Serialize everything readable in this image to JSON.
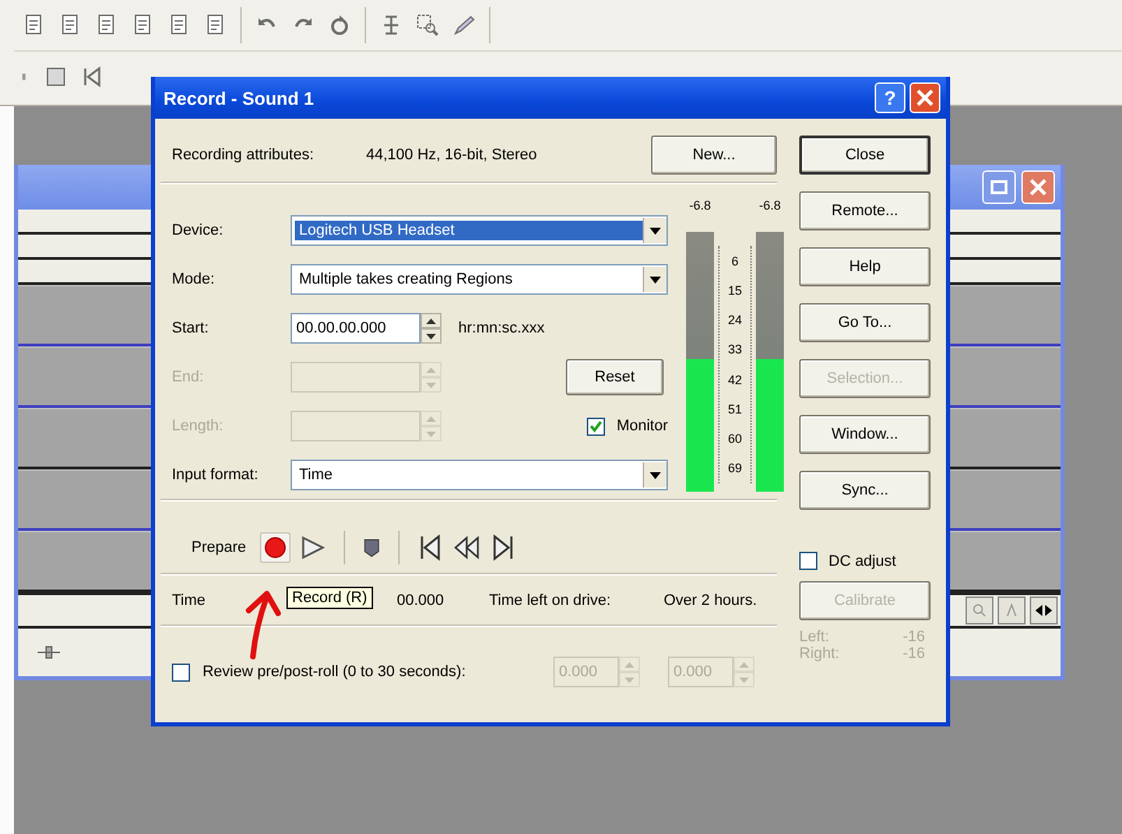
{
  "dialog": {
    "title": "Record - Sound 1",
    "help_button": "?"
  },
  "attributes": {
    "label": "Recording attributes:",
    "value": "44,100 Hz, 16-bit, Stereo"
  },
  "new_button": {
    "label": "New...",
    "disabled": false
  },
  "fields": [
    {
      "kind": "dropdown",
      "label": "Device:",
      "value": "Logitech USB Headset",
      "focused": true,
      "disabled": false
    },
    {
      "kind": "dropdown",
      "label": "Mode:",
      "value": "Multiple takes creating Regions",
      "focused": false,
      "disabled": false
    },
    {
      "kind": "spin",
      "label": "Start:",
      "value": "00.00.00.000",
      "hint": "hr:mn:sc.xxx",
      "focused": false,
      "disabled": false
    },
    {
      "kind": "spin",
      "label": "End:",
      "focused": false,
      "disabled": true
    },
    {
      "kind": "spin",
      "label": "Length:",
      "focused": false,
      "disabled": true
    },
    {
      "kind": "dropdown",
      "label": "Input format:",
      "value": "Time",
      "focused": false,
      "disabled": false
    }
  ],
  "reset_button": {
    "label": "Reset",
    "disabled": false
  },
  "monitor": {
    "label": "Monitor",
    "checked": true
  },
  "meters": {
    "channels": [
      {
        "peak": "-6.8",
        "level": 0.51
      },
      {
        "peak": "-6.8",
        "level": 0.51
      }
    ],
    "scale": [
      "6",
      "15",
      "24",
      "33",
      "42",
      "51",
      "60",
      "69"
    ]
  },
  "side_buttons": [
    {
      "label": "Close",
      "kind": "default",
      "disabled": false
    },
    {
      "label": "Remote...",
      "kind": "normal",
      "disabled": false
    },
    {
      "label": "Help",
      "kind": "normal",
      "disabled": false
    },
    {
      "label": "Go To...",
      "kind": "normal",
      "disabled": false
    },
    {
      "label": "Selection...",
      "kind": "normal",
      "disabled": true
    },
    {
      "label": "Window...",
      "kind": "normal",
      "disabled": false
    },
    {
      "label": "Sync...",
      "kind": "normal",
      "disabled": false
    }
  ],
  "dc_adjust": {
    "label": "DC adjust",
    "checked": false
  },
  "calibrate_button": {
    "label": "Calibrate",
    "disabled": true
  },
  "channel_readings": [
    {
      "label": "Left:",
      "value": "-16",
      "disabled": true
    },
    {
      "label": "Right:",
      "value": "-16",
      "disabled": true
    }
  ],
  "transport": {
    "label": "Prepare",
    "tooltip": "Record (R)"
  },
  "status": {
    "time_recorded_label": "Time",
    "time_recorded_value": "00.000",
    "time_left_label": "Time left on drive:",
    "time_left_value": "Over 2 hours."
  },
  "review": {
    "label": "Review pre/post-roll (0 to 30 seconds):",
    "checked": false,
    "disabled": true,
    "pre_roll": "0.000",
    "post_roll": "0.000"
  }
}
